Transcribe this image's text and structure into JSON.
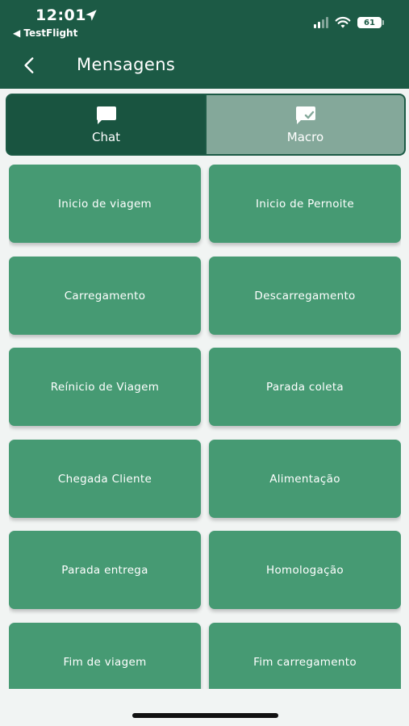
{
  "status": {
    "time": "12:01",
    "back_app": "◀ TestFlight",
    "battery": "61"
  },
  "nav": {
    "title": "Mensagens"
  },
  "tabs": [
    {
      "label": "Chat",
      "icon": "chat-bubble-icon",
      "active": true
    },
    {
      "label": "Macro",
      "icon": "message-check-icon",
      "active": false
    }
  ],
  "macros": [
    "Inicio de viagem",
    "Inicio de Pernoite",
    "Carregamento",
    "Descarregamento",
    "Reínicio de Viagem",
    "Parada coleta",
    "Chegada Cliente",
    "Alimentação",
    "Parada entrega",
    "Homologação",
    "Fim de viagem",
    "Fim carregamento"
  ],
  "colors": {
    "header": "#1c5a45",
    "button": "#469a73",
    "tab_inactive": "#84a89a",
    "background": "#f1f4f3"
  }
}
